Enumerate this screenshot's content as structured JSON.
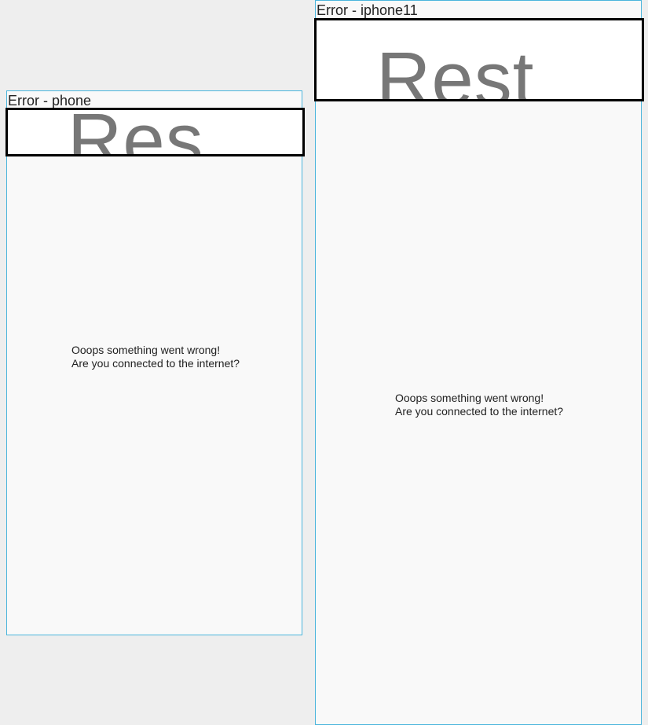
{
  "frames": {
    "phone": {
      "label": "Error - phone",
      "header_text": "Res",
      "message_line1": "Ooops something went wrong!",
      "message_line2": "Are you connected to the internet?"
    },
    "iphone11": {
      "label": "Error - iphone11",
      "header_text": "Rest",
      "message_line1": "Ooops something went wrong!",
      "message_line2": "Are you connected to the internet?"
    }
  },
  "colors": {
    "canvas_background": "#eeeeee",
    "screen_background": "#f9f9f9",
    "frame_border": "#4ab5dc",
    "header_border": "#000000",
    "header_text": "#777777"
  }
}
